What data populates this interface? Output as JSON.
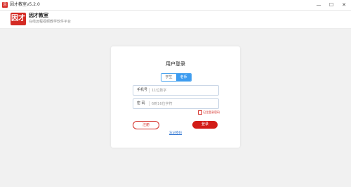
{
  "window": {
    "title": "因才教室v5.2.0",
    "logo_text": "因",
    "controls": [
      "—",
      "☐",
      "✕"
    ]
  },
  "brand": {
    "logo_text": "因才",
    "name": "因才教室",
    "slogan": "在线远程视频教学软件平台"
  },
  "login": {
    "title": "用户登录",
    "tabs": [
      {
        "label": "学生",
        "active": false
      },
      {
        "label": "老师",
        "active": true
      }
    ],
    "phone": {
      "label": "手机号",
      "placeholder": "11位数字"
    },
    "password": {
      "label": "密 码",
      "placeholder": "6到16位字符"
    },
    "remember_label": "记住登录密码",
    "register_label": "注册",
    "login_label": "登录",
    "forgot_label": "忘记密码"
  },
  "colors": {
    "brand_red": "#d42b24",
    "tab_blue": "#3d9cf0",
    "link_blue": "#2f74d0",
    "background": "#f1f1f1"
  }
}
